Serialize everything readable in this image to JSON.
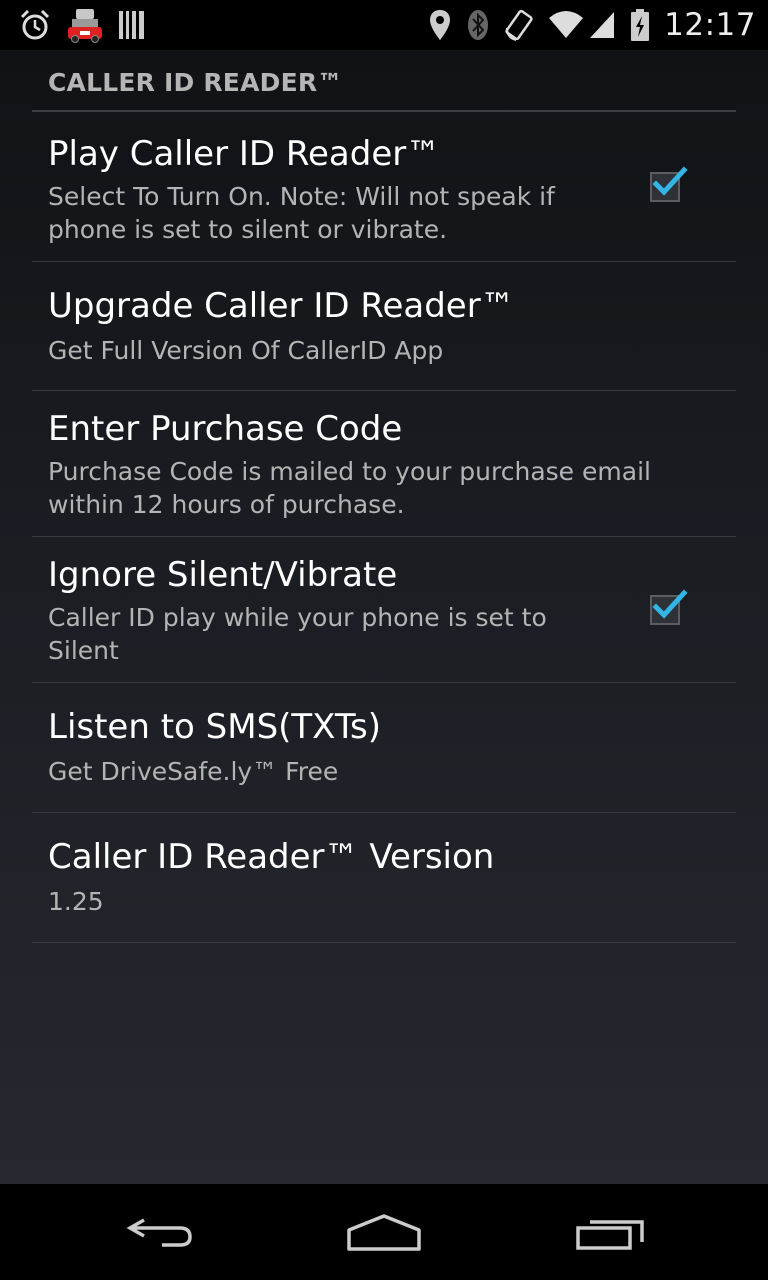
{
  "status_bar": {
    "time": "12:17",
    "left_icons": [
      "alarm-icon",
      "app-notification-icon",
      "barcode-icon"
    ],
    "right_icons": [
      "location-icon",
      "bluetooth-icon",
      "rotation-icon",
      "wifi-icon",
      "signal-icon",
      "battery-icon"
    ]
  },
  "category": {
    "title": "CALLER ID READER™"
  },
  "preferences": [
    {
      "title": "Play Caller ID Reader™",
      "summary": "Select To Turn On. Note: Will not speak if phone is set to silent or vibrate.",
      "checked": true
    },
    {
      "title": "Upgrade Caller ID Reader™",
      "summary": "Get Full Version Of CallerID App"
    },
    {
      "title": "Enter Purchase Code",
      "summary": "Purchase Code is mailed to your purchase email within 12 hours of purchase."
    },
    {
      "title": "Ignore Silent/Vibrate",
      "summary": "Caller ID play while your phone is set to Silent",
      "checked": true
    },
    {
      "title": "Listen to SMS(TXTs)",
      "summary": "Get DriveSafe.ly™ Free"
    },
    {
      "title": "Caller ID Reader™ Version",
      "summary": "1.25"
    }
  ],
  "nav_bar": {
    "icons": [
      "back-icon",
      "home-icon",
      "recents-icon"
    ]
  },
  "colors": {
    "accent_check": "#33b5e5",
    "title_text": "#ffffff",
    "summary_text": "#b4b4b4",
    "category_text": "#b5b5b5"
  }
}
